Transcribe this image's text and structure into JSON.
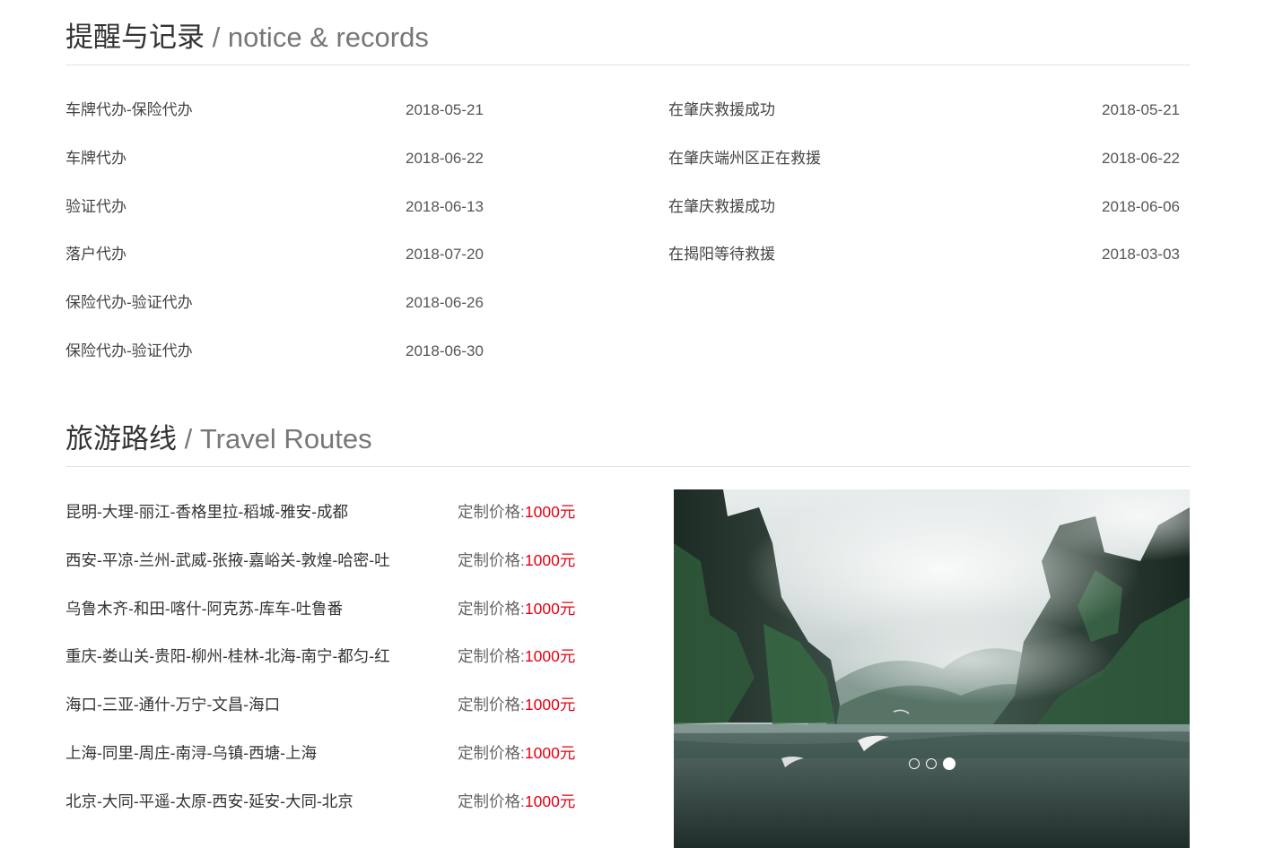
{
  "notice": {
    "title_cn": "提醒与记录",
    "title_en": " / notice & records",
    "left": [
      {
        "title": "车牌代办-保险代办",
        "date": "2018-05-21"
      },
      {
        "title": "车牌代办",
        "date": "2018-06-22"
      },
      {
        "title": "验证代办",
        "date": "2018-06-13"
      },
      {
        "title": "落户代办",
        "date": "2018-07-20"
      },
      {
        "title": "保险代办-验证代办",
        "date": "2018-06-26"
      },
      {
        "title": "保险代办-验证代办",
        "date": "2018-06-30"
      }
    ],
    "right": [
      {
        "title": "在肇庆救援成功",
        "date": "2018-05-21"
      },
      {
        "title": "在肇庆端州区正在救援",
        "date": "2018-06-22"
      },
      {
        "title": "在肇庆救援成功",
        "date": "2018-06-06"
      },
      {
        "title": "在揭阳等待救援",
        "date": "2018-03-03"
      }
    ]
  },
  "travel": {
    "title_cn": "旅游路线",
    "title_en": " / Travel Routes",
    "price_label": "定制价格:",
    "routes": [
      {
        "name": "昆明-大理-丽江-香格里拉-稻城-雅安-成都",
        "price": "1000",
        "unit": "元"
      },
      {
        "name": "西安-平凉-兰州-武威-张掖-嘉峪关-敦煌-哈密-吐",
        "price": "1000",
        "unit": "元"
      },
      {
        "name": "乌鲁木齐-和田-喀什-阿克苏-库车-吐鲁番",
        "price": "1000",
        "unit": "元"
      },
      {
        "name": "重庆-娄山关-贵阳-柳州-桂林-北海-南宁-都匀-红",
        "price": "1000",
        "unit": "元"
      },
      {
        "name": "海口-三亚-通什-万宁-文昌-海口",
        "price": "1000",
        "unit": "元"
      },
      {
        "name": "上海-同里-周庄-南浔-乌镇-西塘-上海",
        "price": "1000",
        "unit": "元"
      },
      {
        "name": "北京-大同-平遥-太原-西安-延安-大同-北京",
        "price": "1000",
        "unit": "元"
      }
    ],
    "carousel": {
      "slide_count": 3,
      "active_index": 2
    }
  },
  "colors": {
    "price_accent": "#e60012",
    "divider": "#e3e3e3"
  }
}
